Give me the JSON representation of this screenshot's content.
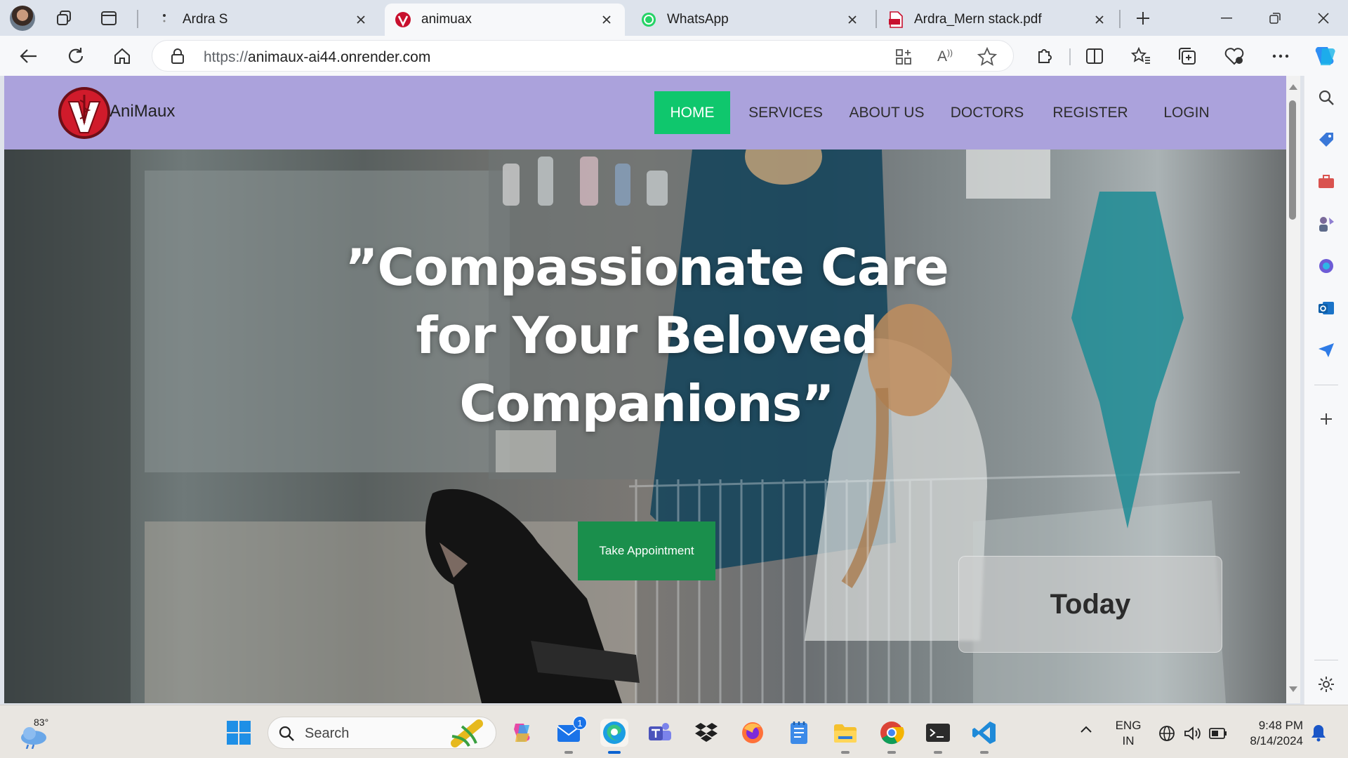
{
  "browser": {
    "tabs": [
      {
        "title": "Ardra S",
        "favicon": "dots-icon"
      },
      {
        "title": "animuax",
        "favicon": "animaux-logo-icon",
        "active": true
      },
      {
        "title": "WhatsApp",
        "favicon": "whatsapp-icon"
      },
      {
        "title": "Ardra_Mern stack.pdf",
        "favicon": "pdf-icon"
      }
    ],
    "address": {
      "scheme": "https://",
      "host": "animaux-ai44.onrender.com"
    }
  },
  "site": {
    "brand": "AniMaux",
    "nav": [
      {
        "label": "HOME",
        "active": true
      },
      {
        "label": "SERVICES"
      },
      {
        "label": "ABOUT US"
      },
      {
        "label": "DOCTORS"
      },
      {
        "label": "REGISTER"
      },
      {
        "label": "LOGIN"
      }
    ],
    "headline_lines": [
      "”Compassionate Care",
      "for Your Beloved",
      "Companions”"
    ],
    "cta_label": "Take Appointment",
    "today_label": "Today",
    "colors": {
      "nav_bg": "#aba2dc",
      "active_nav": "#0fc76d",
      "cta": "#1a8f4c"
    }
  },
  "taskbar": {
    "weather_temp": "83°",
    "search_placeholder": "Search",
    "mail_badge": "1",
    "lang_line1": "ENG",
    "lang_line2": "IN",
    "time": "9:48 PM",
    "date": "8/14/2024"
  }
}
